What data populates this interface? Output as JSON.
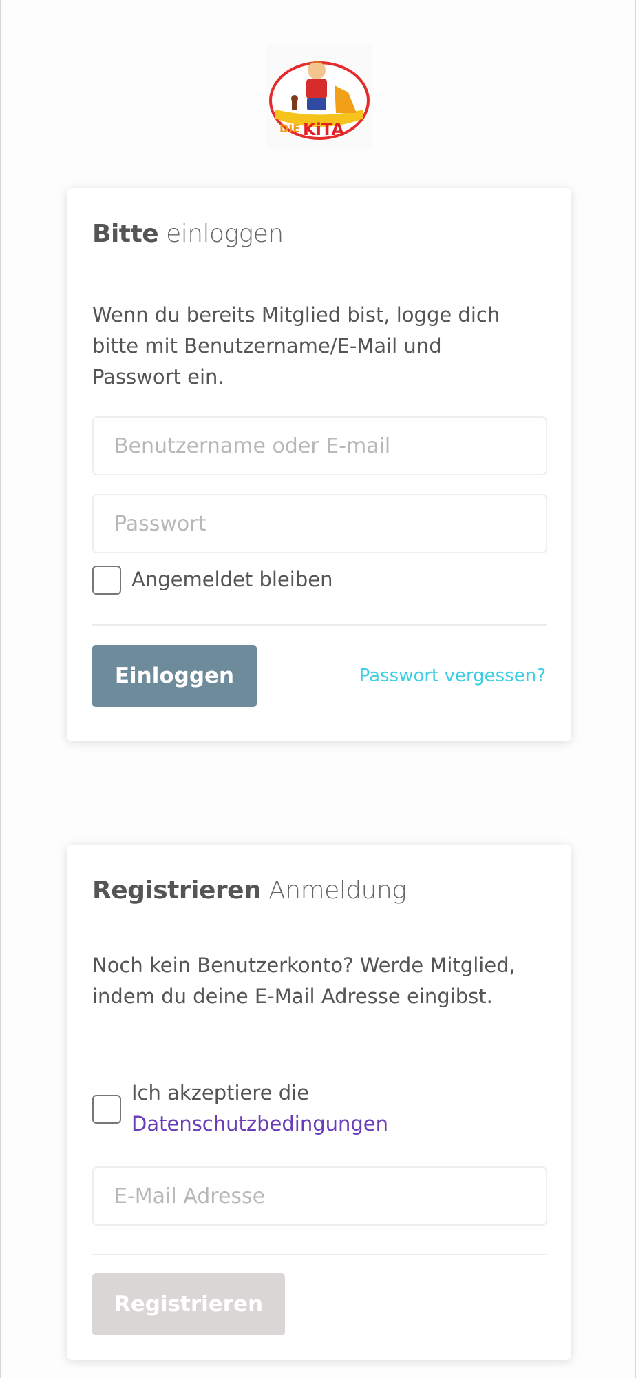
{
  "logo": {
    "alt": "DIE KITA"
  },
  "login": {
    "title_bold": "Bitte",
    "title_light": "einloggen",
    "description": "Wenn du bereits Mitglied bist, logge dich bitte mit Benutzername/E-Mail und Passwort ein.",
    "username_placeholder": "Benutzername oder E-mail",
    "password_placeholder": "Passwort",
    "remember_label": "Angemeldet bleiben",
    "remember_checked": false,
    "submit_label": "Einloggen",
    "forgot_label": "Passwort vergessen?"
  },
  "register": {
    "title_bold": "Registrieren",
    "title_light": "Anmeldung",
    "description": "Noch kein Benutzerkonto? Werde Mitglied, indem du deine E-Mail Adresse eingibst.",
    "accept_prefix": "Ich akzeptiere die",
    "privacy_link": "Datenschutzbedingungen",
    "accept_checked": false,
    "email_placeholder": "E-Mail Adresse",
    "submit_label": "Registrieren"
  },
  "colors": {
    "login_button": "#6e8b9c",
    "register_button": "#dbd6d6",
    "forgot_link": "#3ccfe4",
    "privacy_link": "#6a3db8"
  }
}
